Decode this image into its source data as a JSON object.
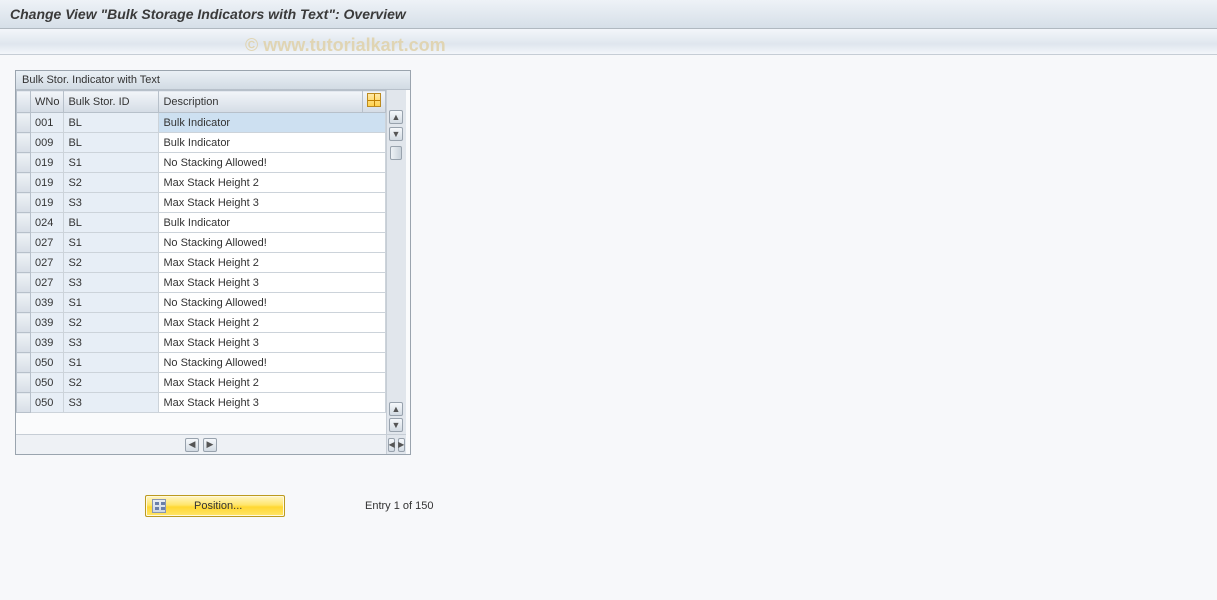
{
  "title": "Change View \"Bulk Storage Indicators with Text\": Overview",
  "watermark": "© www.tutorialkart.com",
  "panel": {
    "title": "Bulk Stor. Indicator with Text",
    "columns": {
      "wno": "WNo",
      "id": "Bulk Stor. ID",
      "desc": "Description"
    },
    "rows": [
      {
        "wno": "001",
        "id": "BL",
        "desc": "Bulk Indicator",
        "selected": true
      },
      {
        "wno": "009",
        "id": "BL",
        "desc": "Bulk Indicator"
      },
      {
        "wno": "019",
        "id": "S1",
        "desc": "No Stacking Allowed!"
      },
      {
        "wno": "019",
        "id": "S2",
        "desc": "Max Stack Height 2"
      },
      {
        "wno": "019",
        "id": "S3",
        "desc": "Max Stack Height 3"
      },
      {
        "wno": "024",
        "id": "BL",
        "desc": "Bulk Indicator"
      },
      {
        "wno": "027",
        "id": "S1",
        "desc": "No Stacking Allowed!"
      },
      {
        "wno": "027",
        "id": "S2",
        "desc": "Max Stack Height 2"
      },
      {
        "wno": "027",
        "id": "S3",
        "desc": "Max Stack Height 3"
      },
      {
        "wno": "039",
        "id": "S1",
        "desc": "No Stacking Allowed!"
      },
      {
        "wno": "039",
        "id": "S2",
        "desc": "Max Stack Height 2"
      },
      {
        "wno": "039",
        "id": "S3",
        "desc": "Max Stack Height 3"
      },
      {
        "wno": "050",
        "id": "S1",
        "desc": "No Stacking Allowed!"
      },
      {
        "wno": "050",
        "id": "S2",
        "desc": "Max Stack Height 2"
      },
      {
        "wno": "050",
        "id": "S3",
        "desc": "Max Stack Height 3"
      }
    ]
  },
  "position_button": "Position...",
  "entry_status": "Entry 1 of 150"
}
